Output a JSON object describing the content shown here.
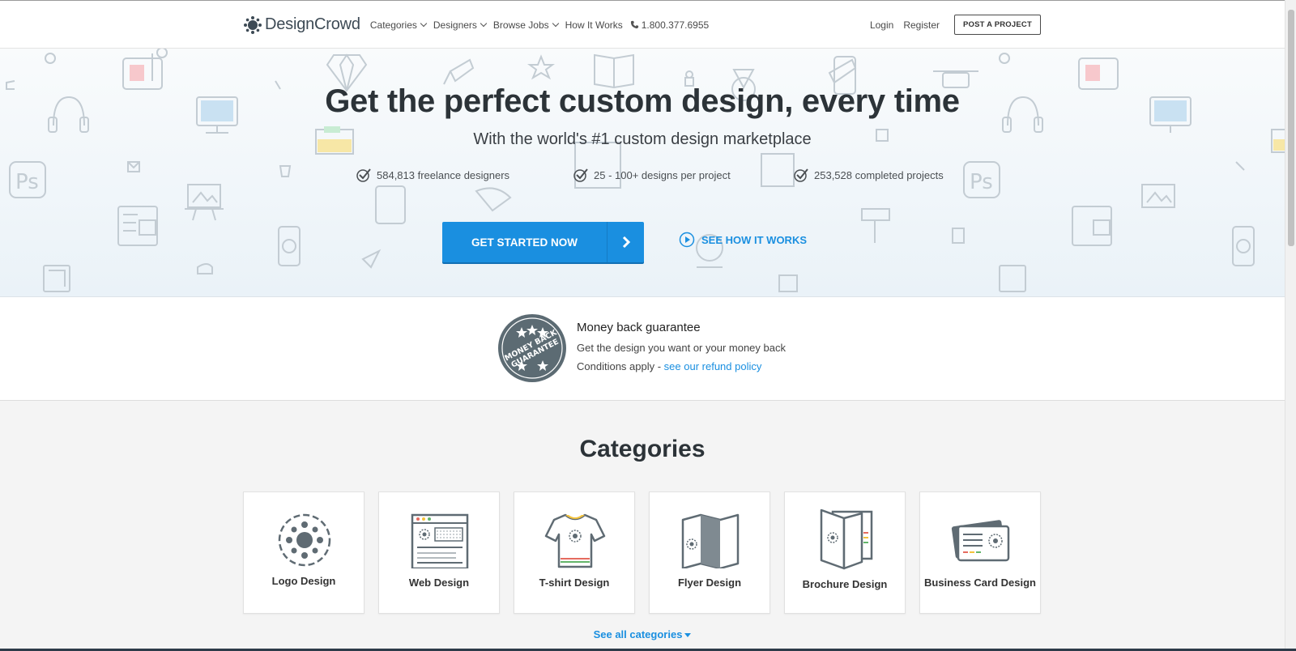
{
  "header": {
    "brand": "DesignCrowd",
    "nav": [
      {
        "label": "Categories",
        "dropdown": true
      },
      {
        "label": "Designers",
        "dropdown": true
      },
      {
        "label": "Browse Jobs",
        "dropdown": true
      },
      {
        "label": "How It Works",
        "dropdown": false
      }
    ],
    "phone": "1.800.377.6955",
    "login": "Login",
    "register": "Register",
    "post_project": "POST A PROJECT"
  },
  "hero": {
    "title": "Get the perfect custom design, every time",
    "subtitle": "With the world's #1 custom design marketplace",
    "stats": [
      "584,813 freelance designers",
      "25 - 100+ designs per project",
      "253,528 completed projects"
    ],
    "cta_label": "GET STARTED NOW",
    "how_label": "SEE HOW IT WORKS"
  },
  "guarantee": {
    "badge_text": [
      "MONEY BACK",
      "GUARANTEE"
    ],
    "title": "Money back guarantee",
    "line1": "Get the design you want or your money back",
    "line2_prefix": "Conditions apply - ",
    "line2_link": "see our refund policy"
  },
  "categories": {
    "title": "Categories",
    "items": [
      {
        "label": "Logo Design",
        "icon": "logo-design-icon"
      },
      {
        "label": "Web Design",
        "icon": "web-design-icon"
      },
      {
        "label": "T-shirt Design",
        "icon": "tshirt-design-icon"
      },
      {
        "label": "Flyer Design",
        "icon": "flyer-design-icon"
      },
      {
        "label": "Brochure Design",
        "icon": "brochure-design-icon"
      },
      {
        "label": "Business Card Design",
        "icon": "business-card-design-icon"
      }
    ],
    "see_all": "See all categories"
  },
  "colors": {
    "accent": "#1a8fe0",
    "dark_text": "#2c3338",
    "icon_gray": "#5f6b73"
  }
}
